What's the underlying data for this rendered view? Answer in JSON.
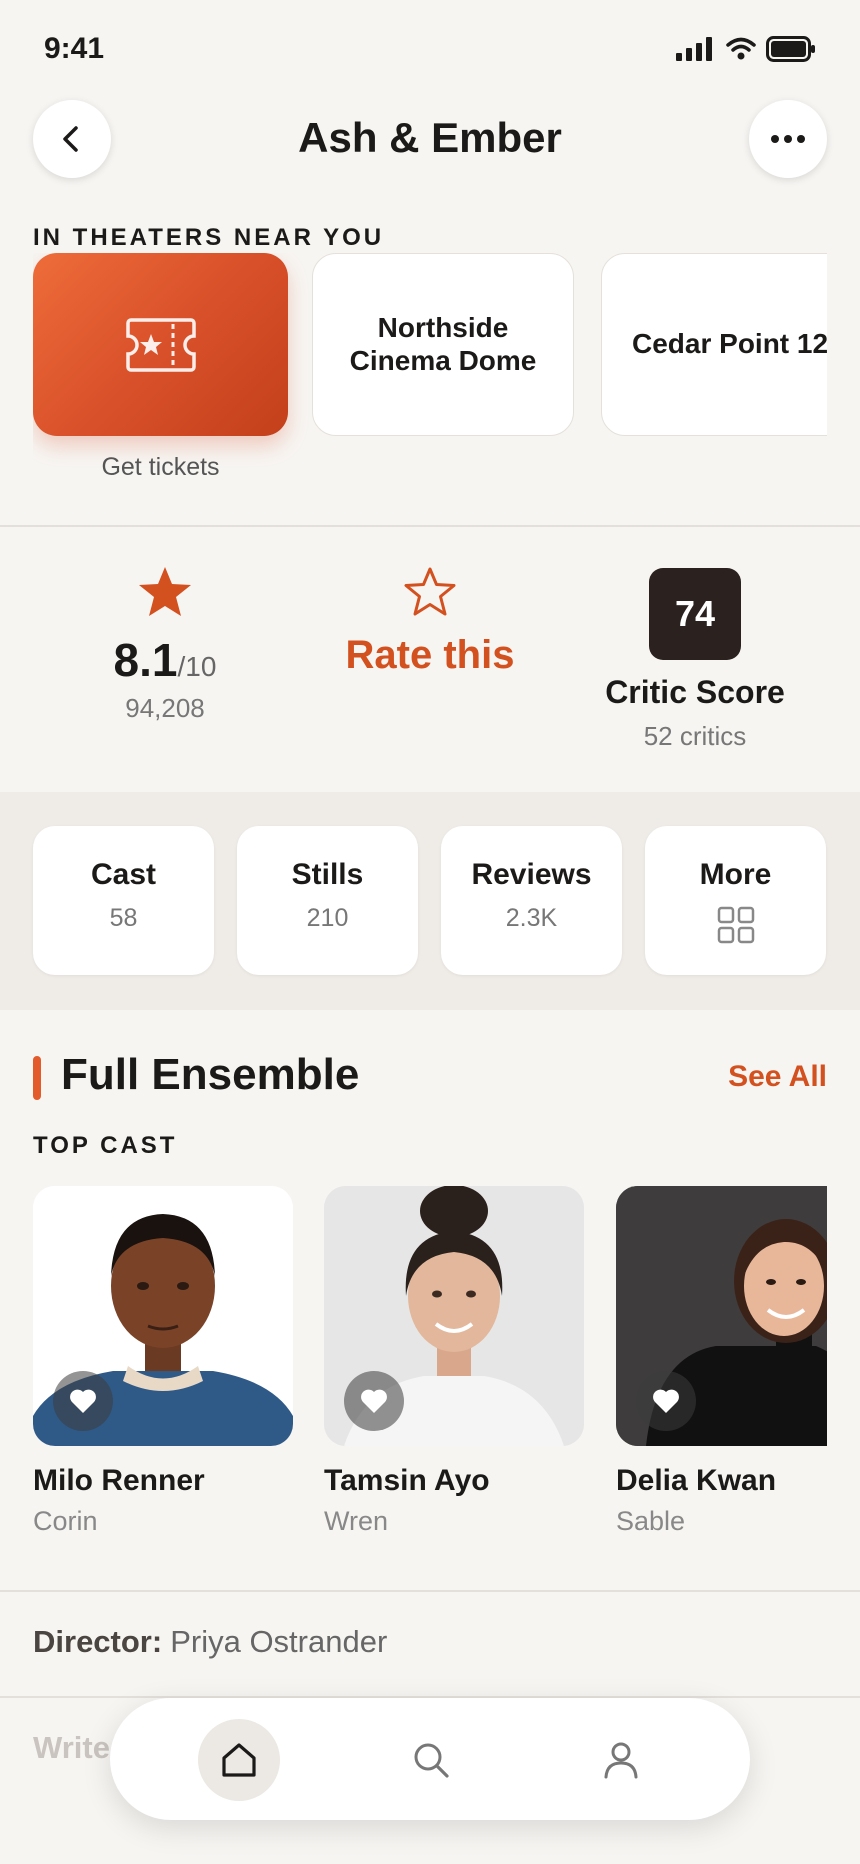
{
  "status_bar": {
    "time": "9:41"
  },
  "header": {
    "title": "Ash & Ember"
  },
  "theaters": {
    "label": "IN THEATERS NEAR YOU",
    "tickets_label": "Get tickets",
    "items": [
      "Northside Cinema Dome",
      "Cedar Point 12"
    ]
  },
  "ratings": {
    "user": {
      "score": "8.1",
      "denominator": "/10",
      "votes": "94,208"
    },
    "rate_label": "Rate this",
    "critic": {
      "score": "74",
      "title": "Critic Score",
      "count": "52 critics"
    }
  },
  "chips": [
    {
      "title": "Cast",
      "sub": "58"
    },
    {
      "title": "Stills",
      "sub": "210"
    },
    {
      "title": "Reviews",
      "sub": "2.3K"
    },
    {
      "title": "More"
    }
  ],
  "ensemble": {
    "title": "Full Ensemble",
    "see_all": "See All",
    "top_cast_label": "TOP CAST",
    "cast": [
      {
        "name": "Milo Renner",
        "role": "Corin"
      },
      {
        "name": "Tamsin Ayo",
        "role": "Wren"
      },
      {
        "name": "Delia Kwan",
        "role": "Sable"
      }
    ]
  },
  "credits": {
    "director_label": "Director:",
    "director_name": "Priya Ostrander",
    "writer_label": "Write"
  },
  "colors": {
    "accent": "#d3501f",
    "background": "#f7f5f2",
    "critic_box": "#2b2220"
  }
}
